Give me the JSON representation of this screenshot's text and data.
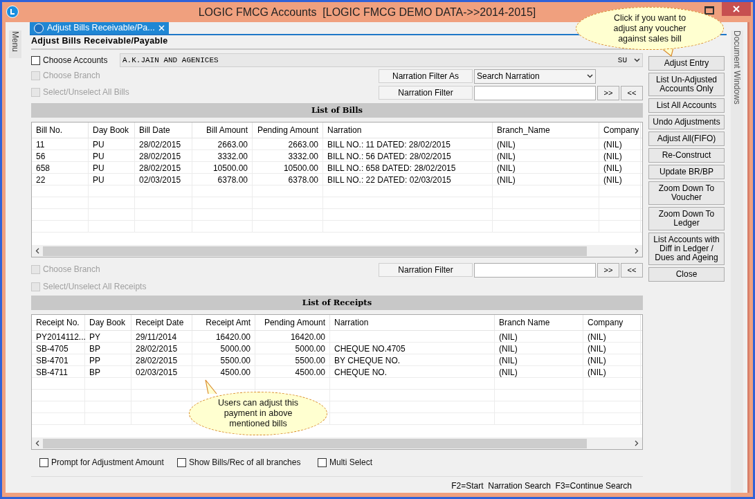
{
  "window": {
    "title": "LOGIC FMCG Accounts  [LOGIC FMCG DEMO DATA->>2014-2015]"
  },
  "side_panels": {
    "left": "Menu",
    "right": "Document Windows"
  },
  "tab": {
    "label": "Adjust Bills Receivable/Pa...",
    "selected": true
  },
  "heading": "Adjust Bills Receivable/Payable",
  "account": {
    "checkbox": {
      "label": "Choose Accounts",
      "checked": false,
      "disabled": false
    },
    "value": "A.K.JAIN AND AGENICES",
    "code": "SU"
  },
  "bill_options": [
    {
      "label": "Choose Branch",
      "checked": false,
      "disabled": true
    },
    {
      "label": "Select/Unselect All Bills",
      "checked": false,
      "disabled": true
    }
  ],
  "bill_filter": {
    "filter_as_label": "Narration Filter As",
    "filter_as_value": "Search Narration",
    "filter_label": "Narration Filter",
    "buttons": [
      ">>",
      "<<"
    ]
  },
  "bills": {
    "title": "List of Bills",
    "columns": [
      "Bill No.",
      "Day Book",
      "Bill Date",
      "Bill Amount",
      "Pending Amount",
      "Narration",
      "Branch_Name",
      "Company"
    ],
    "rows": [
      [
        "11",
        "PU",
        "28/02/2015",
        "2663.00",
        "2663.00",
        "BILL NO.: 11 DATED: 28/02/2015",
        "(NIL)",
        "(NIL)"
      ],
      [
        "56",
        "PU",
        "28/02/2015",
        "3332.00",
        "3332.00",
        "BILL NO.: 56 DATED: 28/02/2015",
        "(NIL)",
        "(NIL)"
      ],
      [
        "658",
        "PU",
        "28/02/2015",
        "10500.00",
        "10500.00",
        "BILL NO.: 658 DATED: 28/02/2015",
        "(NIL)",
        "(NIL)"
      ],
      [
        "22",
        "PU",
        "02/03/2015",
        "6378.00",
        "6378.00",
        "BILL NO.: 22 DATED: 02/03/2015",
        "(NIL)",
        "(NIL)"
      ]
    ]
  },
  "receipt_options": [
    {
      "label": "Choose Branch",
      "checked": false,
      "disabled": true
    },
    {
      "label": "Select/Unselect All Receipts",
      "checked": false,
      "disabled": true
    }
  ],
  "receipt_filter": {
    "filter_label": "Narration Filter",
    "buttons": [
      ">>",
      "<<"
    ]
  },
  "receipts": {
    "title": "List of Receipts",
    "columns": [
      "Receipt No.",
      "Day Book",
      "Receipt Date",
      "Receipt Amt",
      "Pending Amount",
      "Narration",
      "Branch Name",
      "Company"
    ],
    "rows": [
      [
        "PY2014112...",
        "PY",
        "29/11/2014",
        "16420.00",
        "16420.00",
        "",
        "(NIL)",
        "(NIL)"
      ],
      [
        "SB-4705",
        "BP",
        "28/02/2015",
        "5000.00",
        "5000.00",
        "CHEQUE NO.4705",
        "(NIL)",
        "(NIL)"
      ],
      [
        "SB-4701",
        "PP",
        "28/02/2015",
        "5500.00",
        "5500.00",
        "BY CHEQUE NO.",
        "(NIL)",
        "(NIL)"
      ],
      [
        "SB-4711",
        "BP",
        "02/03/2015",
        "4500.00",
        "4500.00",
        "CHEQUE NO.",
        "(NIL)",
        "(NIL)"
      ]
    ]
  },
  "footer_options": [
    {
      "label": "Prompt for Adjustment Amount",
      "checked": false,
      "disabled": false
    },
    {
      "label": "Show Bills/Rec of all branches",
      "checked": false,
      "disabled": false
    },
    {
      "label": "Multi Select",
      "checked": false,
      "disabled": false
    }
  ],
  "actions": [
    "Adjust Entry",
    "List Un-Adjusted Accounts Only",
    "List All Accounts",
    "Undo Adjustments",
    "Adjust All(FIFO)",
    "Re-Construct",
    "Update BR/BP",
    "Zoom Down To Voucher",
    "Zoom Down To Ledger",
    "List Accounts with Diff in Ledger / Dues and Ageing",
    "Close"
  ],
  "status_bar": "F2=Start  Narration Search  F3=Continue Search",
  "callouts": [
    "Click if you want to adjust any voucher against sales bill",
    "Users can adjust this payment in above mentioned bills"
  ]
}
